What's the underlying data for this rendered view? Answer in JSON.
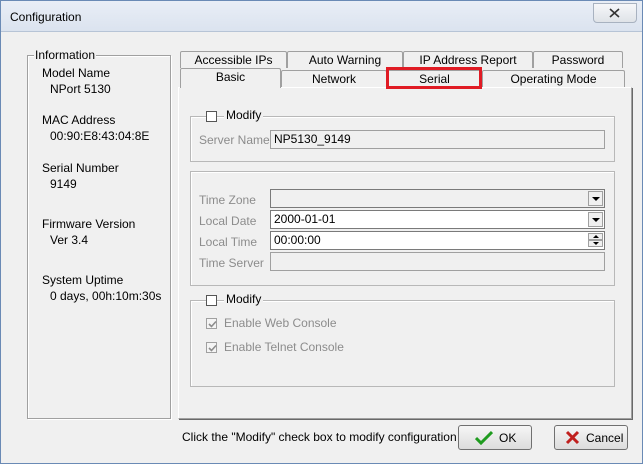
{
  "window": {
    "title": "Configuration"
  },
  "info": {
    "legend": "Information",
    "model_name_label": "Model Name",
    "model_name": "NPort 5130",
    "mac_label": "MAC Address",
    "mac": "00:90:E8:43:04:8E",
    "serial_label": "Serial Number",
    "serial": "9149",
    "firmware_label": "Firmware Version",
    "firmware": "Ver 3.4",
    "uptime_label": "System Uptime",
    "uptime": "0 days, 00h:10m:30s"
  },
  "tabs": {
    "accessible_ips": "Accessible IPs",
    "auto_warning": "Auto Warning",
    "ip_report": "IP Address Report",
    "password": "Password",
    "basic": "Basic",
    "network": "Network",
    "serial": "Serial",
    "operating_mode": "Operating Mode"
  },
  "server": {
    "modify_label": "Modify",
    "server_name_label": "Server Name",
    "server_name": "NP5130_9149"
  },
  "time": {
    "time_zone_label": "Time Zone",
    "time_zone": "",
    "local_date_label": "Local Date",
    "local_date": "2000-01-01",
    "local_time_label": "Local Time",
    "local_time": "00:00:00",
    "time_server_label": "Time Server",
    "time_server": ""
  },
  "console": {
    "modify_label": "Modify",
    "web_console_label": "Enable Web Console",
    "telnet_console_label": "Enable Telnet Console"
  },
  "footer": {
    "status": "Click the \"Modify\" check box to modify configuration",
    "ok_label": "OK",
    "cancel_label": "Cancel"
  },
  "colors": {
    "highlight": "#e01b24",
    "ok_icon": "#1e9b1e",
    "cancel_icon": "#c0201e"
  }
}
